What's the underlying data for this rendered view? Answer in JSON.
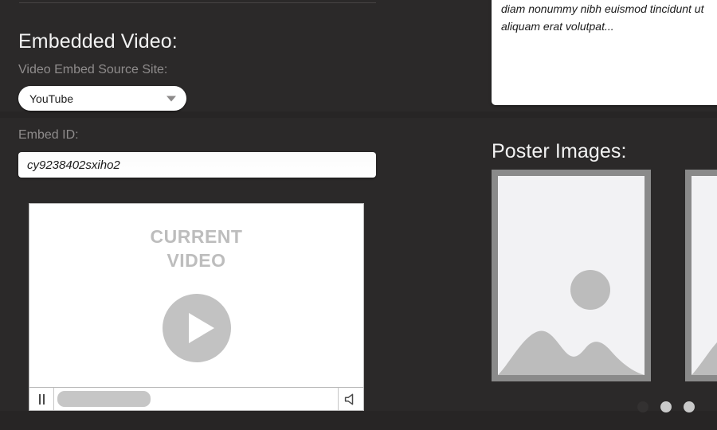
{
  "colors": {
    "background": "#272525",
    "panel": "#2b2929",
    "heading_text": "#f2f2f4",
    "label_text": "#8f8c8c",
    "input_bg": "#ffffff",
    "input_text": "#1b1b1b",
    "placeholder_gray": "#bdbdbd",
    "poster_frame": "#8a8a8a",
    "poster_fill": "#bcbcbc",
    "dot_active": "#333131",
    "dot_inactive": "#c9c9c9"
  },
  "video_section": {
    "title": "Embedded Video:",
    "source_site_label": "Video Embed Source Site:",
    "source_site_value": "YouTube",
    "source_site_options": [
      "YouTube"
    ],
    "dropdown_icon": "chevron-down-icon",
    "embed_id_label": "Embed ID:",
    "embed_id_value": "cy9238402sxiho2"
  },
  "player": {
    "placeholder_line1": "CURRENT",
    "placeholder_line2": "VIDEO",
    "play_icon": "play-icon",
    "pause_icon": "pause-icon",
    "volume_icon": "speaker-icon",
    "progress_percent": 33
  },
  "description": {
    "text": "diam nonummy nibh euismod tincidunt ut\naliquam erat volutpat..."
  },
  "posters": {
    "title": "Poster Images:",
    "items": [
      {
        "icon": "image-placeholder-icon"
      },
      {
        "icon": "image-placeholder-icon"
      }
    ],
    "dots": [
      {
        "state": "active"
      },
      {
        "state": "inactive"
      },
      {
        "state": "inactive"
      }
    ]
  }
}
